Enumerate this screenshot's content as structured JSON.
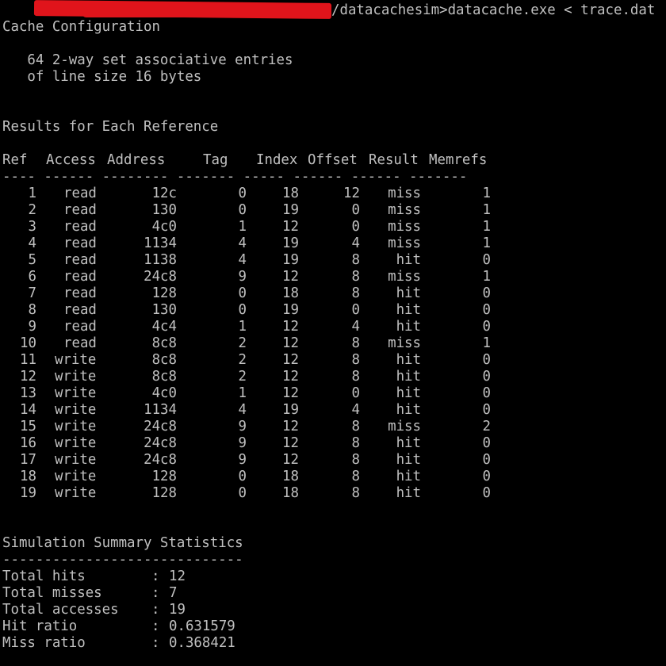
{
  "command": {
    "prompt_suffix": "/datacachesim>datacache.exe < trace.dat"
  },
  "config": {
    "heading": "Cache Configuration",
    "line1": "   64 2-way set associative entries",
    "line2": "   of line size 16 bytes"
  },
  "results": {
    "heading": "Results for Each Reference",
    "headers": [
      "Ref",
      "Access",
      "Address",
      "Tag",
      "Index",
      "Offset",
      "Result",
      "Memrefs"
    ],
    "underline": "---- ------ -------- ------- ----- ------ ------ -------",
    "rows": [
      [
        "1",
        "read",
        "12c",
        "0",
        "18",
        "12",
        "miss",
        "1"
      ],
      [
        "2",
        "read",
        "130",
        "0",
        "19",
        "0",
        "miss",
        "1"
      ],
      [
        "3",
        "read",
        "4c0",
        "1",
        "12",
        "0",
        "miss",
        "1"
      ],
      [
        "4",
        "read",
        "1134",
        "4",
        "19",
        "4",
        "miss",
        "1"
      ],
      [
        "5",
        "read",
        "1138",
        "4",
        "19",
        "8",
        "hit",
        "0"
      ],
      [
        "6",
        "read",
        "24c8",
        "9",
        "12",
        "8",
        "miss",
        "1"
      ],
      [
        "7",
        "read",
        "128",
        "0",
        "18",
        "8",
        "hit",
        "0"
      ],
      [
        "8",
        "read",
        "130",
        "0",
        "19",
        "0",
        "hit",
        "0"
      ],
      [
        "9",
        "read",
        "4c4",
        "1",
        "12",
        "4",
        "hit",
        "0"
      ],
      [
        "10",
        "read",
        "8c8",
        "2",
        "12",
        "8",
        "miss",
        "1"
      ],
      [
        "11",
        "write",
        "8c8",
        "2",
        "12",
        "8",
        "hit",
        "0"
      ],
      [
        "12",
        "write",
        "8c8",
        "2",
        "12",
        "8",
        "hit",
        "0"
      ],
      [
        "13",
        "write",
        "4c0",
        "1",
        "12",
        "0",
        "hit",
        "0"
      ],
      [
        "14",
        "write",
        "1134",
        "4",
        "19",
        "4",
        "hit",
        "0"
      ],
      [
        "15",
        "write",
        "24c8",
        "9",
        "12",
        "8",
        "miss",
        "2"
      ],
      [
        "16",
        "write",
        "24c8",
        "9",
        "12",
        "8",
        "hit",
        "0"
      ],
      [
        "17",
        "write",
        "24c8",
        "9",
        "12",
        "8",
        "hit",
        "0"
      ],
      [
        "18",
        "write",
        "128",
        "0",
        "18",
        "8",
        "hit",
        "0"
      ],
      [
        "19",
        "write",
        "128",
        "0",
        "18",
        "8",
        "hit",
        "0"
      ]
    ]
  },
  "summary": {
    "heading": "Simulation Summary Statistics",
    "underline": "-----------------------------",
    "stats": [
      {
        "label": "Total hits",
        "value": "12"
      },
      {
        "label": "Total misses",
        "value": "7"
      },
      {
        "label": "Total accesses",
        "value": "19"
      },
      {
        "label": "Hit ratio",
        "value": "0.631579"
      },
      {
        "label": "Miss ratio",
        "value": "0.368421"
      }
    ]
  },
  "colors": {
    "background": "#000000",
    "text": "#c0c0c0",
    "redaction": "#e0141b"
  }
}
